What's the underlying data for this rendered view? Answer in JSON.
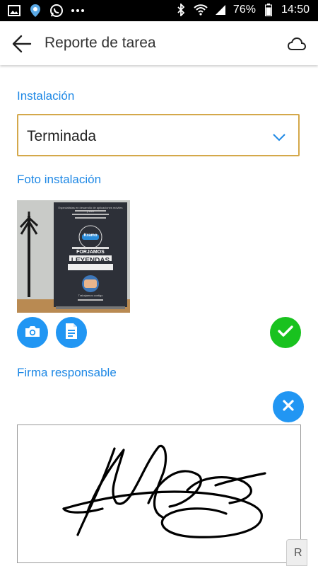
{
  "status_bar": {
    "battery": "76%",
    "time": "14:50",
    "left_icons": [
      "gallery-icon",
      "location-icon",
      "whatsapp-icon",
      "more-icon"
    ],
    "right_icons": [
      "bluetooth-icon",
      "wifi-icon",
      "signal-icon",
      "battery-icon"
    ]
  },
  "app_bar": {
    "title": "Reporte de tarea",
    "back_icon": "arrow-left-icon",
    "sync_icon": "cloud-icon"
  },
  "form": {
    "installation": {
      "label": "Instalación",
      "value": "Terminada"
    },
    "photo": {
      "label": "Foto instalación",
      "image_text": {
        "banner_top": "Especialistas en desarrollo de aplicaciones móviles y web",
        "brand": "Kramo",
        "headline_1": "FORJAMOS",
        "headline_2": "LEYENDAS",
        "bottom": "Trabajamos contigo"
      },
      "camera_icon": "camera-icon",
      "file_icon": "document-icon",
      "status_icon": "check-icon"
    },
    "signature": {
      "label": "Firma responsable",
      "clear_icon": "close-icon",
      "scroll_tab": "R"
    }
  },
  "colors": {
    "accent": "#1e88e5",
    "field_border": "#d4a84a",
    "success": "#19c21f",
    "status_bar": "#000000"
  }
}
